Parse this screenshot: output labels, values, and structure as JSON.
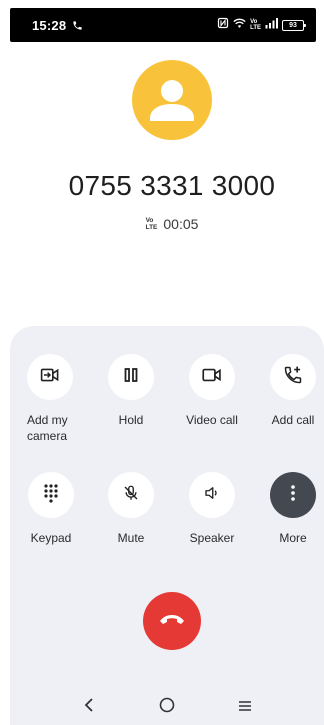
{
  "status_bar": {
    "time": "15:28",
    "volte_top": "Vo",
    "volte_bottom": "LTE",
    "battery": "93"
  },
  "call": {
    "number": "0755 3331 3000",
    "badge_top": "Vo",
    "badge_bottom": "LTE",
    "duration": "00:05"
  },
  "controls": [
    {
      "label": "Add my camera",
      "icon": "camera-arrow-icon"
    },
    {
      "label": "Hold",
      "icon": "pause-icon"
    },
    {
      "label": "Video call",
      "icon": "video-camera-icon"
    },
    {
      "label": "Add call",
      "icon": "add-call-icon"
    },
    {
      "label": "Keypad",
      "icon": "dialpad-icon"
    },
    {
      "label": "Mute",
      "icon": "mic-off-icon"
    },
    {
      "label": "Speaker",
      "icon": "speaker-icon"
    },
    {
      "label": "More",
      "icon": "more-vertical-icon"
    }
  ],
  "colors": {
    "avatar": "#f8c33a",
    "panel": "#eef0f6",
    "end_call": "#e53935",
    "more_button": "#444851"
  }
}
